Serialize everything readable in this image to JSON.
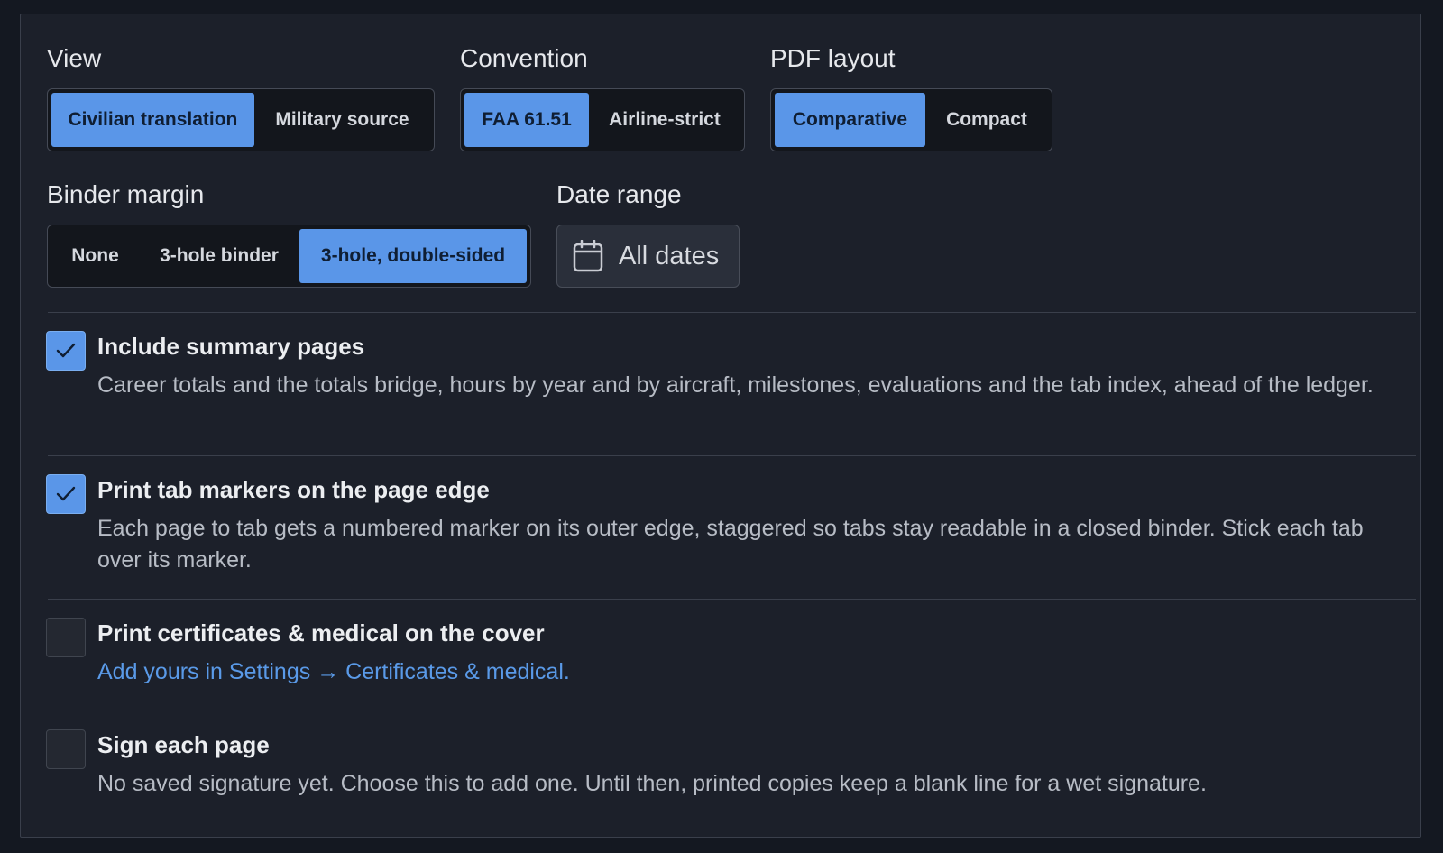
{
  "view": {
    "label": "View",
    "options": [
      "Civilian translation",
      "Military source"
    ],
    "selected": "Civilian translation"
  },
  "convention": {
    "label": "Convention",
    "options": [
      "FAA 61.51",
      "Airline-strict"
    ],
    "selected": "FAA 61.51"
  },
  "pdf_layout": {
    "label": "PDF layout",
    "options": [
      "Comparative",
      "Compact"
    ],
    "selected": "Comparative"
  },
  "binder_margin": {
    "label": "Binder margin",
    "options": [
      "None",
      "3-hole binder",
      "3-hole, double-sided"
    ],
    "selected": "3-hole, double-sided"
  },
  "date_range": {
    "label": "Date range",
    "value": "All dates",
    "icon": "calendar-icon"
  },
  "options": [
    {
      "title": "Include summary pages",
      "description": "Career totals and the totals bridge, hours by year and by aircraft, milestones, evaluations and the tab index, ahead of the ledger.",
      "checked": true
    },
    {
      "title": "Print tab markers on the page edge",
      "description": "Each page to tab gets a numbered marker on its outer edge, staggered so tabs stay readable in a closed binder. Stick each tab over its marker.",
      "checked": true
    },
    {
      "title": "Print certificates & medical on the cover",
      "link": "Add yours in Settings → Certificates & medical.",
      "checked": false
    },
    {
      "title": "Sign each page",
      "description": "No saved signature yet. Choose this to add one. Until then, printed copies keep a blank line for a wet signature.",
      "checked": false
    }
  ],
  "colors": {
    "accent": "#5a96e8",
    "panel_bg": "#1c202a",
    "page_bg": "#141821",
    "link": "#5a9ae8"
  }
}
